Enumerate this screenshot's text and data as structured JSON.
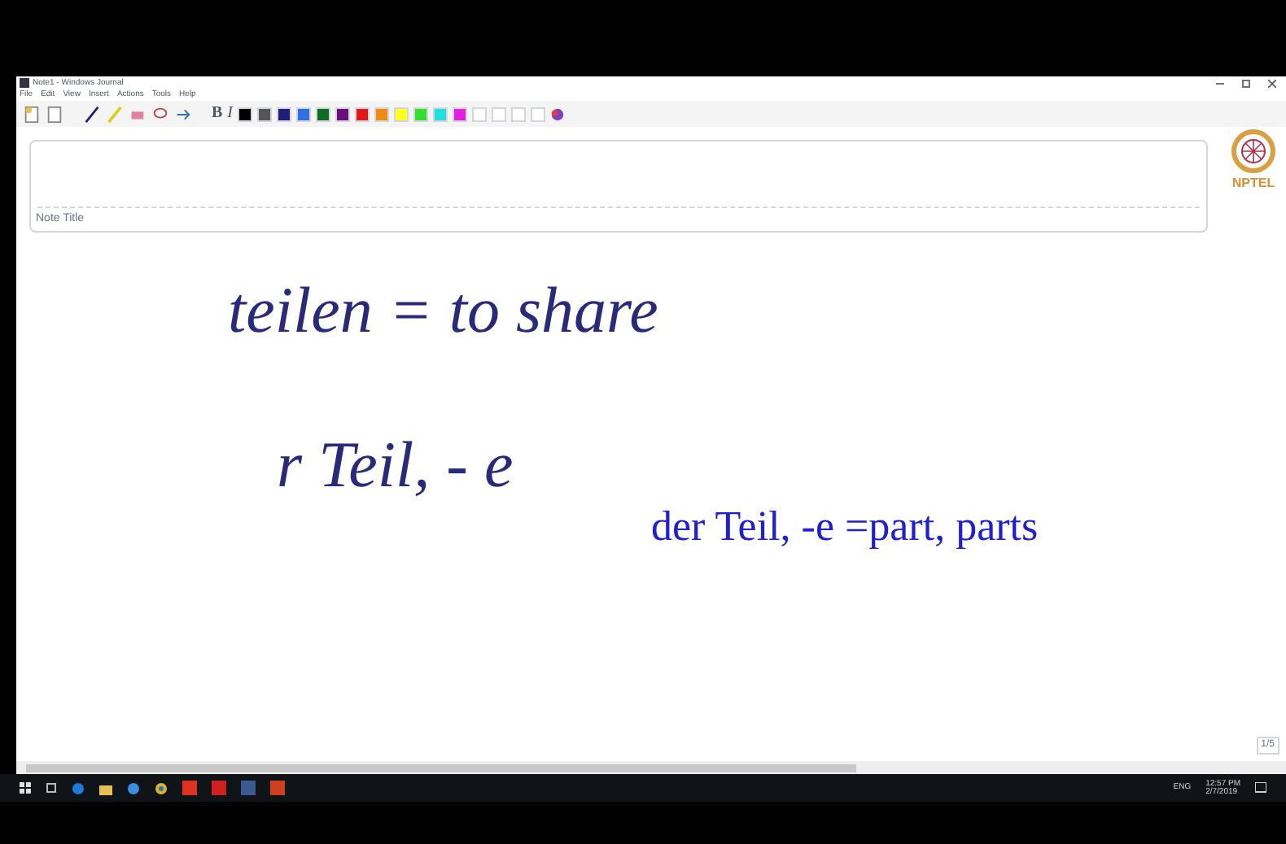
{
  "window": {
    "title": "Note1 - Windows Journal"
  },
  "menu": [
    "File",
    "Edit",
    "View",
    "Insert",
    "Actions",
    "Tools",
    "Help"
  ],
  "format_buttons": [
    "B",
    "I"
  ],
  "palette": [
    {
      "color": "#000000"
    },
    {
      "color": "#555555"
    },
    {
      "color": "#1f1f7a"
    },
    {
      "color": "#2f6fe0"
    },
    {
      "color": "#0f6b1f"
    },
    {
      "color": "#6a0f7a"
    },
    {
      "color": "#e01818"
    },
    {
      "color": "#f08a10"
    },
    {
      "color": "#ffff20"
    },
    {
      "color": "#30e030"
    },
    {
      "color": "#20e0e0"
    },
    {
      "color": "#e020e0"
    },
    {
      "color": "#ffffff"
    },
    {
      "color": "#ffffff"
    },
    {
      "color": "#ffffff"
    },
    {
      "color": "#ffffff"
    }
  ],
  "logo": {
    "text": "NPTEL"
  },
  "note_title": {
    "placeholder": "Note Title"
  },
  "ink": [
    {
      "kind": "handwriting",
      "text": "teilen = to share"
    },
    {
      "kind": "handwriting",
      "text": "r Teil, - e"
    }
  ],
  "typed_text": "der Teil, -e =part, parts",
  "page_indicator": "1/5",
  "taskbar": {
    "language": "ENG",
    "time": "12:57 PM",
    "date": "2/7/2019"
  }
}
